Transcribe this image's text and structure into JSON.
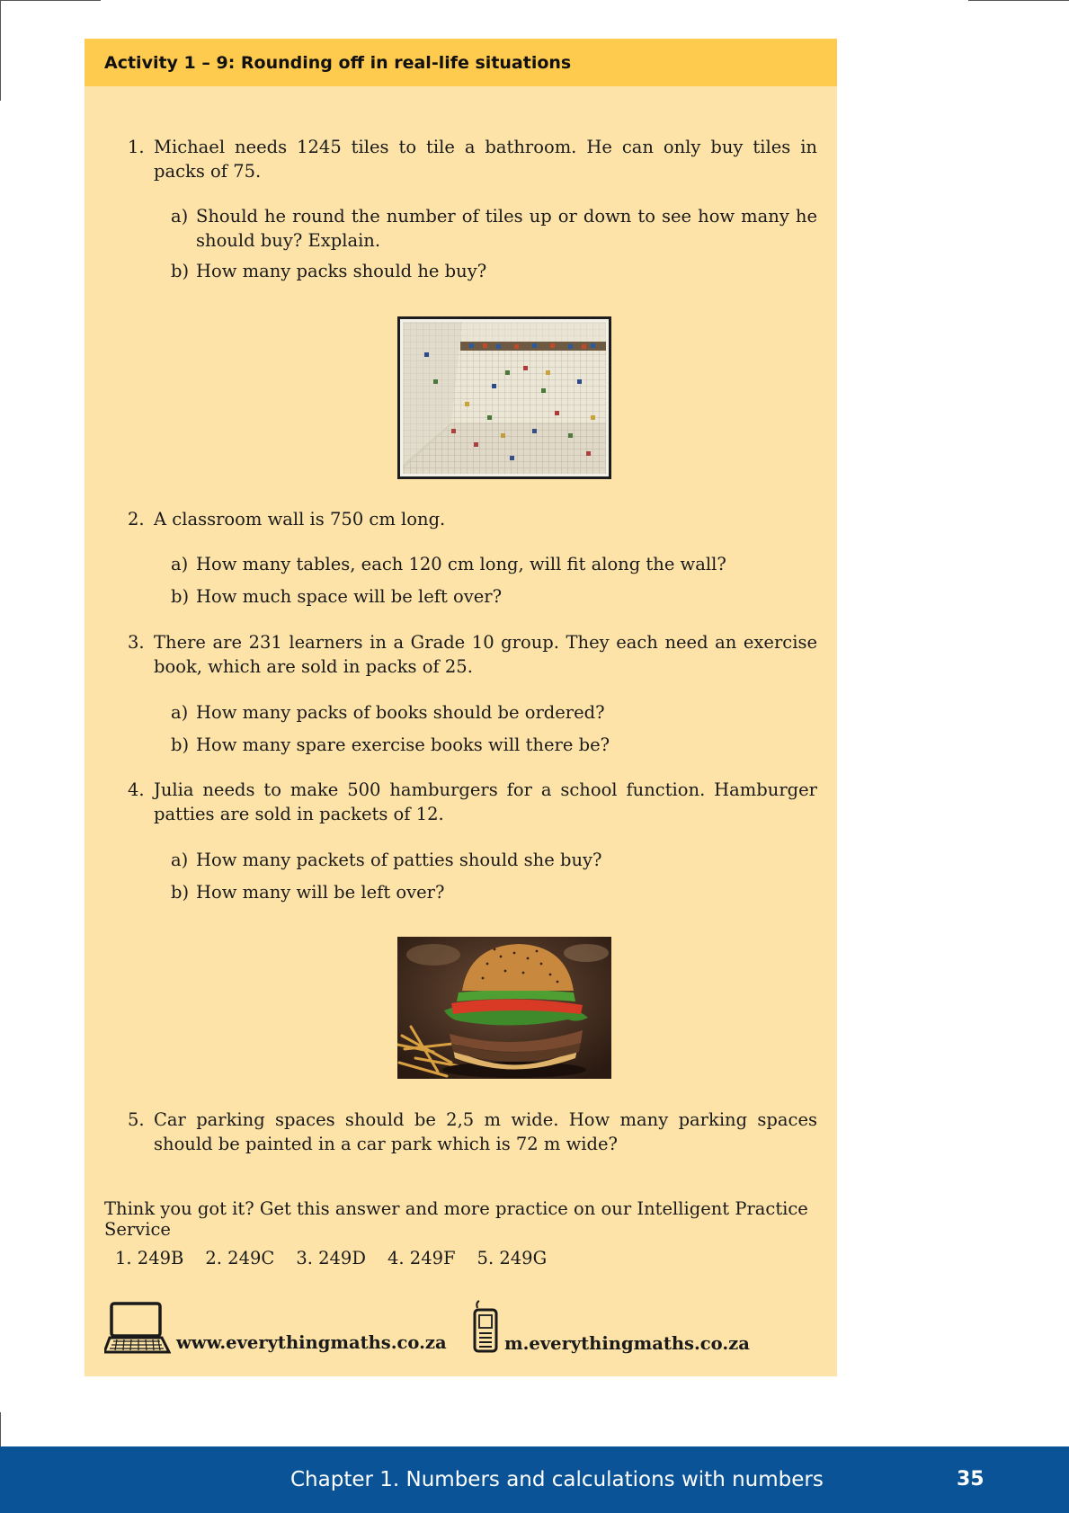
{
  "activity": {
    "title": "Activity 1 – 9:  Rounding off in real-life situations"
  },
  "questions": [
    {
      "num": "1.",
      "text": "Michael needs 1245 tiles to tile a bathroom.  He can only buy tiles in packs of 75.",
      "parts": [
        {
          "label": "a)",
          "text": "Should he round the number of tiles up or down to see how many he should buy? Explain."
        },
        {
          "label": "b)",
          "text": "How many packs should he buy?"
        }
      ]
    },
    {
      "num": "2.",
      "text": "A classroom wall is 750 cm long.",
      "parts": [
        {
          "label": "a)",
          "text": "How many tables, each 120 cm long, will fit along the wall?"
        },
        {
          "label": "b)",
          "text": "How much space will be left over?"
        }
      ]
    },
    {
      "num": "3.",
      "text": "There are 231 learners in a Grade 10 group.  They each need an exercise book, which are sold in packs of 25.",
      "parts": [
        {
          "label": "a)",
          "text": "How many packs of books should be ordered?"
        },
        {
          "label": "b)",
          "text": "How many spare exercise books will there be?"
        }
      ]
    },
    {
      "num": "4.",
      "text": "Julia needs to make 500 hamburgers for a school function.  Hamburger patties are sold in packets of 12.",
      "parts": [
        {
          "label": "a)",
          "text": "How many packets of patties should she buy?"
        },
        {
          "label": "b)",
          "text": "How many will be left over?"
        }
      ]
    },
    {
      "num": "5.",
      "text": "Car parking spaces should be 2,5 m wide. How many parking spaces should be painted in a car park which is 72 m wide?"
    }
  ],
  "practice": {
    "prompt": "Think you got it? Get this answer and more practice on our Intelligent Practice Service",
    "codes": [
      "1. 249B",
      "2. 249C",
      "3. 249D",
      "4. 249F",
      "5. 249G"
    ],
    "web_url": "www.everythingmaths.co.za",
    "mobile_url": "m.everythingmaths.co.za"
  },
  "footer": {
    "chapter": "Chapter 1.   Numbers and calculations with numbers",
    "page": "35"
  },
  "icons": {
    "photo_tiles": "bathroom-tiles-photo",
    "photo_burger": "hamburger-photo",
    "web": "laptop-icon",
    "mobile": "mobile-phone-icon"
  },
  "colors": {
    "activity_bg": "#fde3a7",
    "activity_header": "#fecb4f",
    "footer_bg": "#0a5396"
  }
}
